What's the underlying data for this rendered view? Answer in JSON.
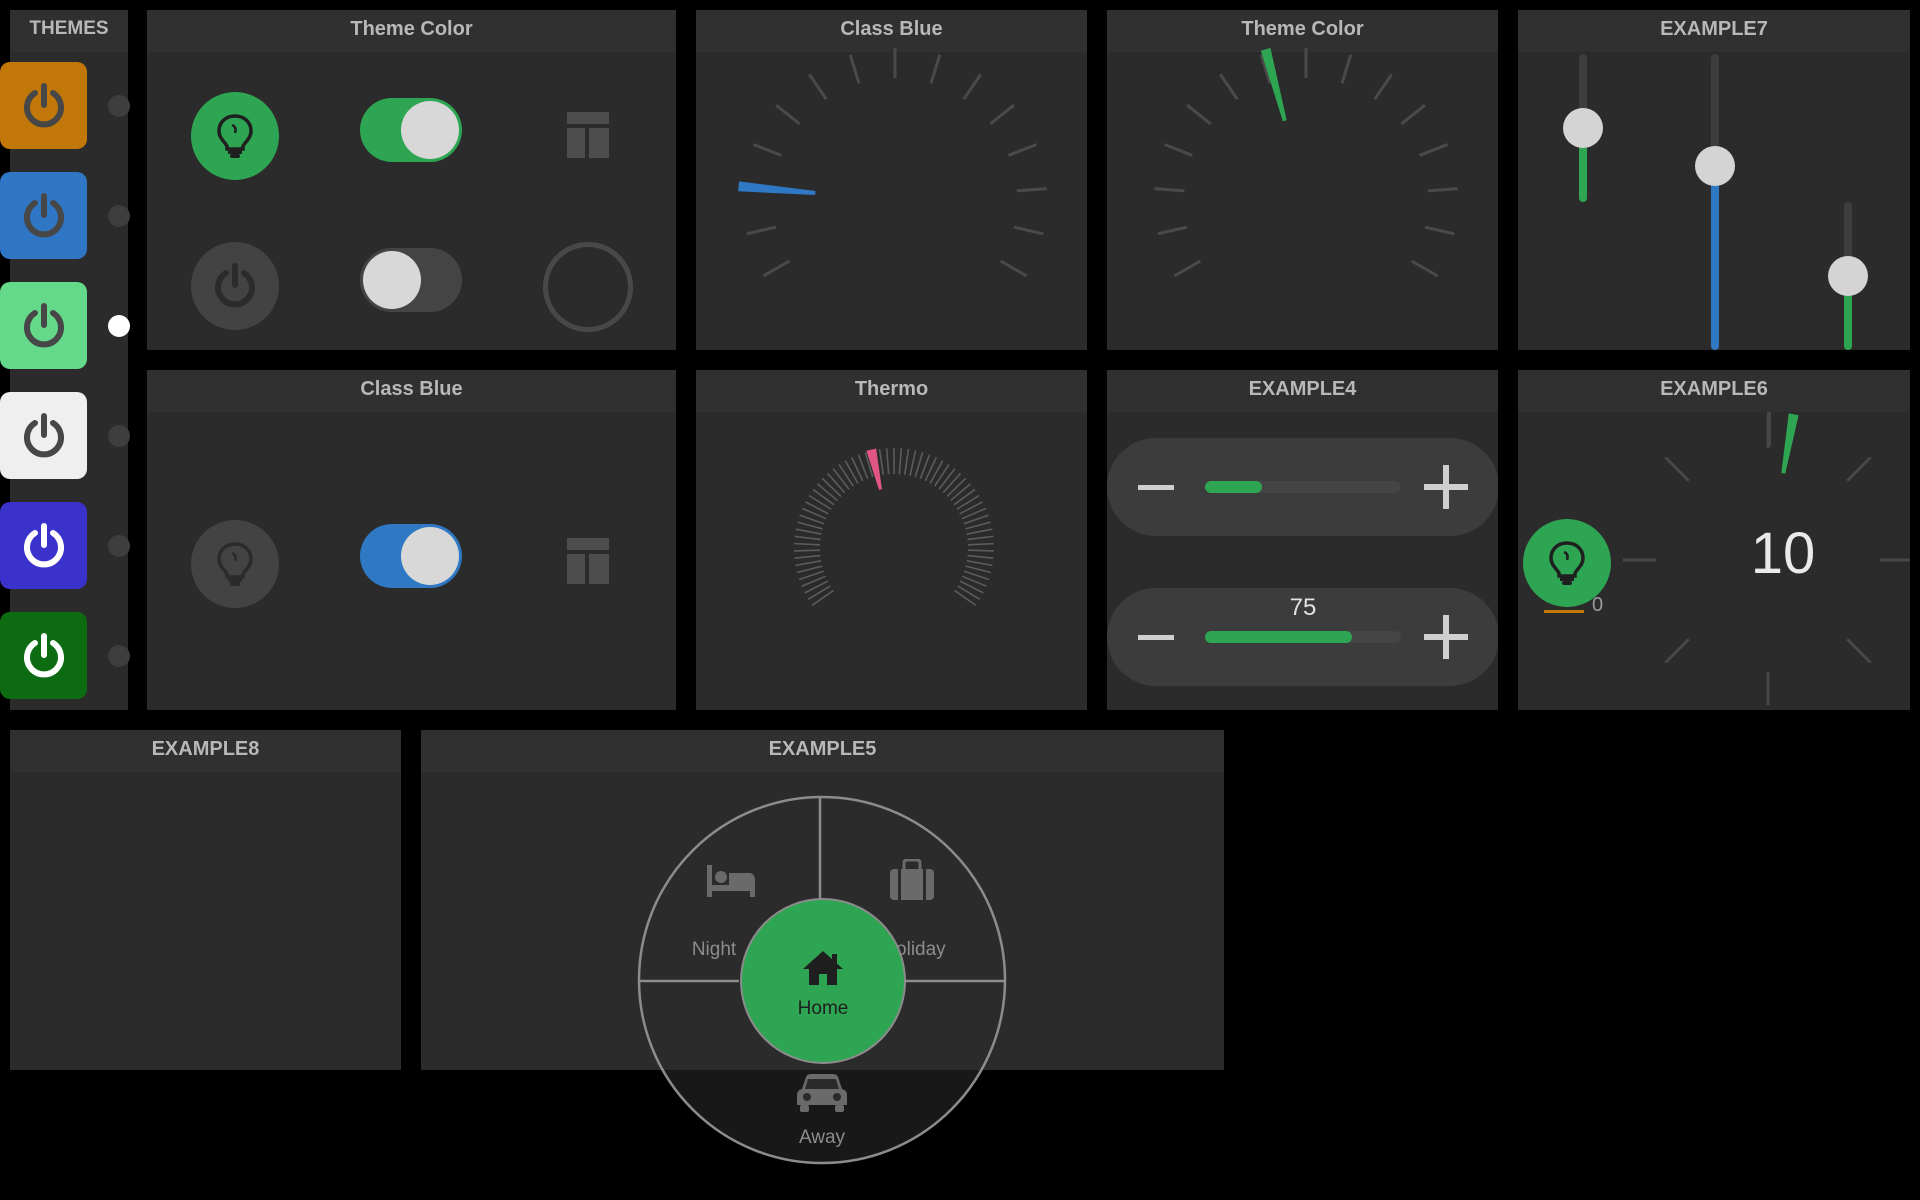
{
  "themes": {
    "title": "THEMES",
    "buttons": [
      {
        "name": "orange",
        "bg": "#c27809",
        "icon_color": "#474747"
      },
      {
        "name": "blue",
        "bg": "#2f77c4",
        "icon_color": "#474747"
      },
      {
        "name": "light-green",
        "bg": "#64d98a",
        "icon_color": "#474747"
      },
      {
        "name": "white",
        "bg": "#efefef",
        "icon_color": "#474747"
      },
      {
        "name": "indigo",
        "bg": "#3b32cc",
        "icon_color": "#ffffff"
      },
      {
        "name": "dark-green",
        "bg": "#0d6b12",
        "icon_color": "#ffffff"
      }
    ],
    "selected_index": 2
  },
  "panels": {
    "theme_color_1": "Theme Color",
    "class_blue_1": "Class Blue",
    "theme_color_2": "Theme Color",
    "example7": "EXAMPLE7",
    "class_blue_2": "Class Blue",
    "thermo": "Thermo",
    "example4": "EXAMPLE4",
    "example6": "EXAMPLE6",
    "example8": "EXAMPLE8",
    "example5": "EXAMPLE5"
  },
  "colors": {
    "green": "#2ea552",
    "blue": "#2f78c4",
    "pink": "#e05585",
    "muted": "#474747",
    "tick": "#4a4a4a"
  },
  "theme_color_widget": {
    "bulb_on": true,
    "toggle_top_on": true,
    "power_off": true,
    "toggle_bottom_on": false
  },
  "gauges": {
    "class_blue": {
      "needle_color": "#2f78c4"
    },
    "theme_color": {
      "needle_color": "#2ea552"
    },
    "thermo": {
      "needle_color": "#e05585"
    }
  },
  "example7": {
    "sliders": [
      {
        "name": "green-slider",
        "level": 0.5,
        "color": "#2ea552"
      },
      {
        "name": "blue-slider",
        "level": 0.62,
        "color": "#2f78c4"
      },
      {
        "name": "green-slider-small",
        "level": 0.5,
        "color": "#2ea552"
      }
    ]
  },
  "example4": {
    "stepper1": {
      "value": "",
      "level": 0.29
    },
    "stepper2": {
      "value": "75",
      "level": 0.75
    }
  },
  "example6": {
    "value": "10",
    "min_label": "0"
  },
  "example5": {
    "modes": {
      "home": "Home",
      "night": "Night",
      "holiday": "Holiday",
      "away": "Away"
    },
    "selected": "Home"
  }
}
